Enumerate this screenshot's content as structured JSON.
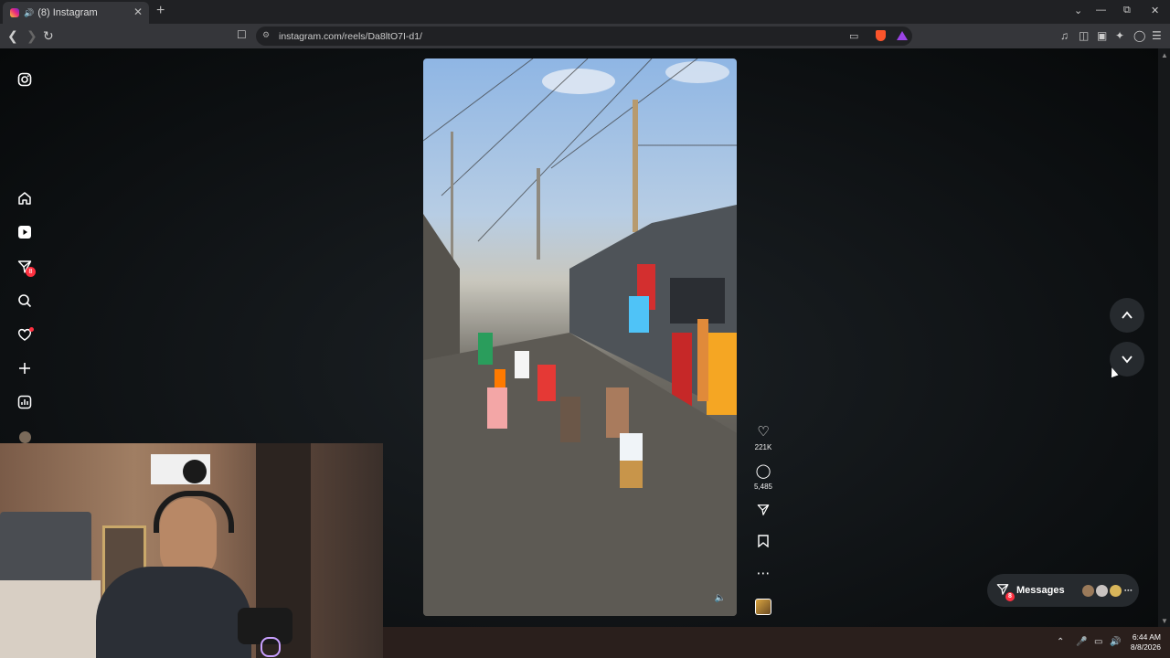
{
  "browser": {
    "tab": {
      "title": "(8) Instagram",
      "audio_icon": "speaker-icon",
      "close_icon": "close-icon"
    },
    "new_tab_icon": "plus-icon",
    "window_controls": [
      "chevron-down-icon",
      "minimize-icon",
      "restore-icon",
      "close-icon"
    ],
    "nav": [
      "back-icon",
      "forward-icon",
      "reload-icon"
    ],
    "url": "instagram.com/reels/Da8ltO7I-d1/",
    "toolbar_icons": [
      "music-icon",
      "sidebar-icon",
      "wallet-icon",
      "leo-ai-icon",
      "vpn-icon",
      "menu-icon"
    ]
  },
  "sidebar": {
    "logo_icon": "instagram-icon",
    "items": [
      {
        "name": "home",
        "icon": "home-icon"
      },
      {
        "name": "reels",
        "icon": "reels-icon"
      },
      {
        "name": "messages",
        "icon": "direct-icon",
        "badge": "8"
      },
      {
        "name": "search",
        "icon": "search-icon"
      },
      {
        "name": "notifications",
        "icon": "heart-icon"
      },
      {
        "name": "create",
        "icon": "plus-icon"
      },
      {
        "name": "dashboard",
        "icon": "dashboard-icon"
      },
      {
        "name": "profile",
        "icon": "avatar"
      }
    ]
  },
  "reel": {
    "likes": "221K",
    "comments": "5,485",
    "actions": [
      "like-icon",
      "comment-icon",
      "share-icon",
      "save-icon",
      "more-icon"
    ]
  },
  "messages_pill": {
    "label": "Messages",
    "badge": "8"
  },
  "taskbar": {
    "time": "6:44 AM",
    "date": "8/8/2026"
  },
  "colors": {
    "page_bg": "#0d1012",
    "accent_red": "#ff3040",
    "button_bg": "#262a2e"
  }
}
